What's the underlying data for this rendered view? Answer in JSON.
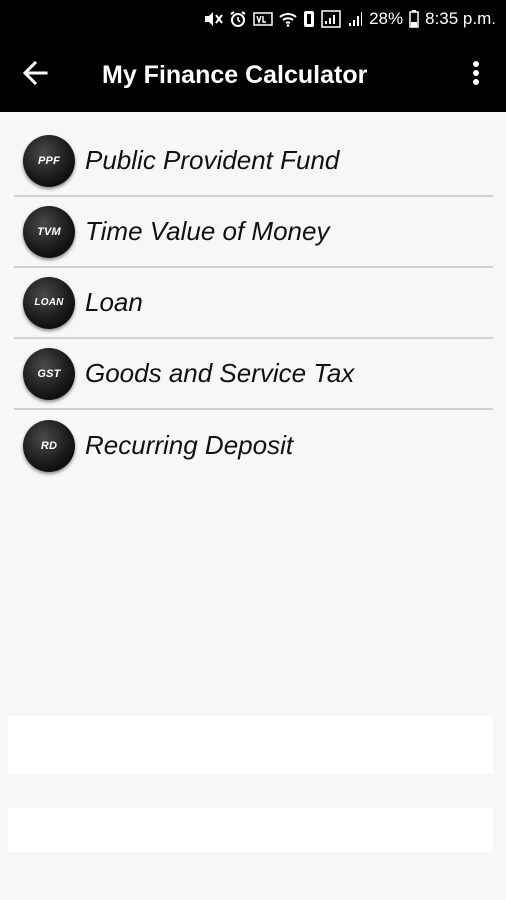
{
  "status_bar": {
    "battery": "28%",
    "time": "8:35 p.m."
  },
  "app_bar": {
    "title": "My Finance Calculator",
    "back_icon": "arrow-left-icon",
    "menu_icon": "more-vert-icon"
  },
  "calculators": [
    {
      "abbr": "PPF",
      "label": "Public Provident Fund"
    },
    {
      "abbr": "TVM",
      "label": "Time Value of Money"
    },
    {
      "abbr": "LOAN",
      "label": "Loan"
    },
    {
      "abbr": "GST",
      "label": "Goods and Service Tax"
    },
    {
      "abbr": "RD",
      "label": "Recurring Deposit"
    }
  ]
}
